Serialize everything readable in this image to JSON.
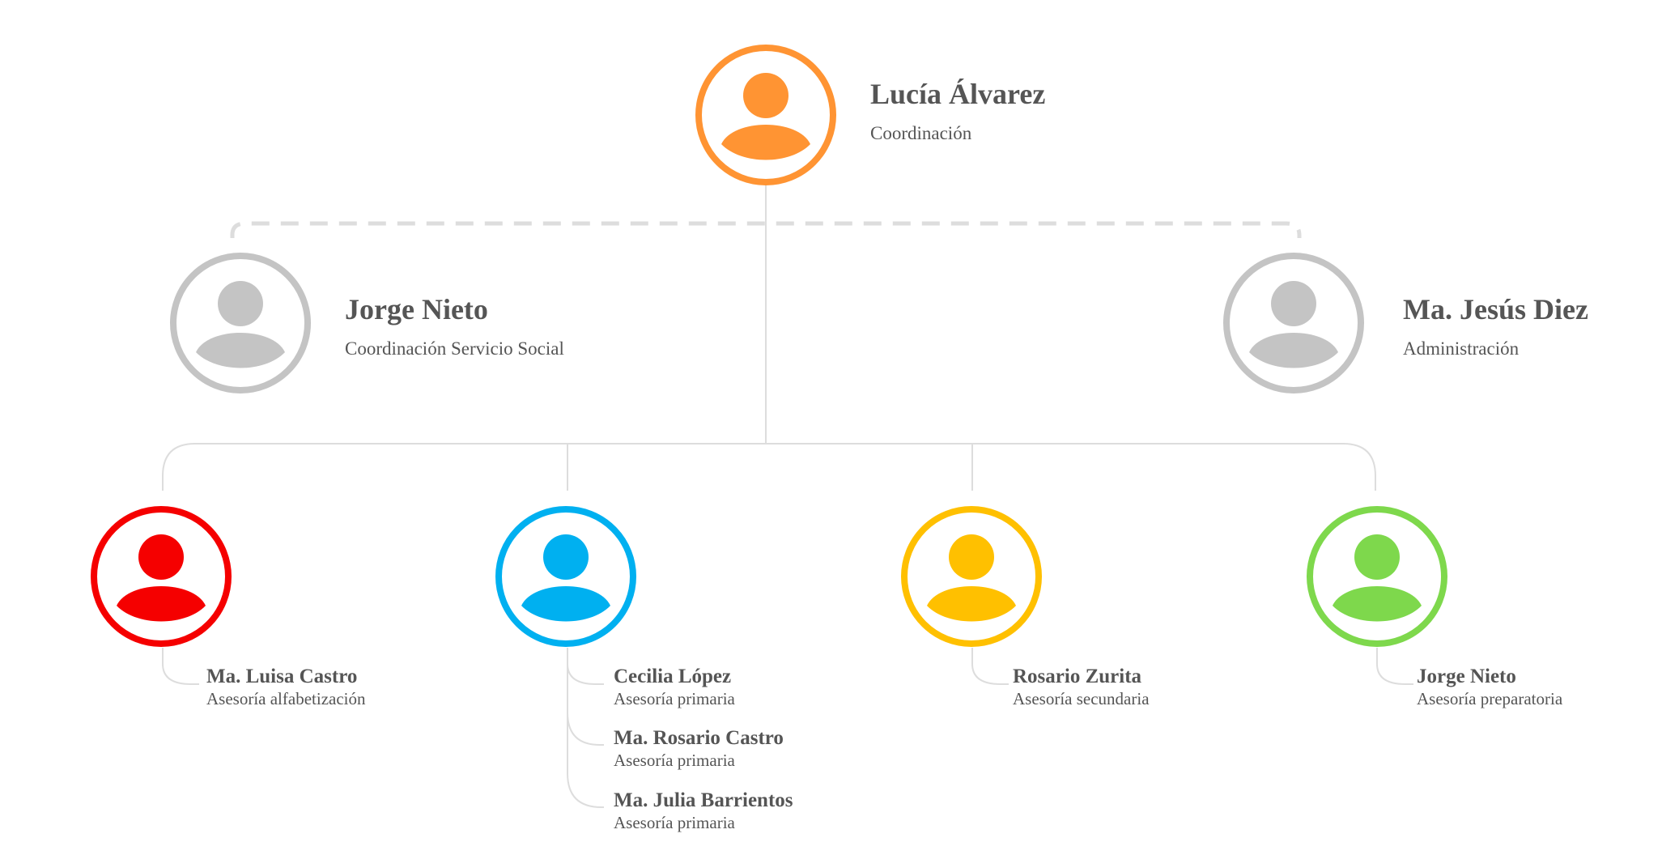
{
  "colors": {
    "coordinator": "#FF9433",
    "secondary": "#C4C4C4",
    "red": "#F50000",
    "blue": "#00B0F0",
    "yellow": "#FFC000",
    "green": "#7ED84C",
    "line": "#DDDDDD",
    "text": "#555555"
  },
  "icon": "person-icon",
  "top": {
    "name": "Lucía Álvarez",
    "role": "Coordinación"
  },
  "side_left": {
    "name": "Jorge Nieto",
    "role": "Coordinación Servicio Social"
  },
  "side_right": {
    "name": "Ma. Jesús Diez",
    "role": "Administración"
  },
  "branches": [
    {
      "members": [
        {
          "name": "Ma. Luisa Castro",
          "role": "Asesoría alfabetización"
        }
      ]
    },
    {
      "members": [
        {
          "name": "Cecilia López",
          "role": "Asesoría primaria"
        },
        {
          "name": "Ma. Rosario Castro",
          "role": "Asesoría primaria"
        },
        {
          "name": "Ma. Julia Barrientos",
          "role": "Asesoría primaria"
        }
      ]
    },
    {
      "members": [
        {
          "name": "Rosario Zurita",
          "role": "Asesoría secundaria"
        }
      ]
    },
    {
      "members": [
        {
          "name": "Jorge Nieto",
          "role": "Asesoría preparatoria"
        }
      ]
    }
  ]
}
